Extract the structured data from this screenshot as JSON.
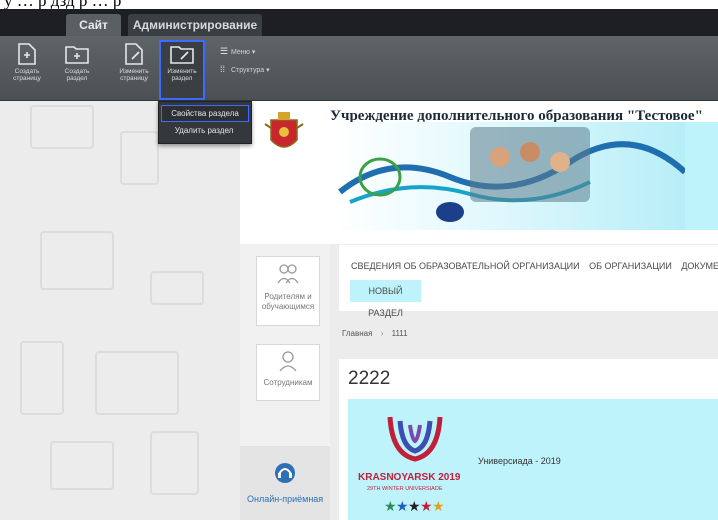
{
  "caption": "у             …    р          дзд    р          …         р",
  "tabs": {
    "site": "Сайт",
    "admin": "Администрирование"
  },
  "toolbar": {
    "create_page": "Создать страницу",
    "create_section": "Создать раздел",
    "edit_page": "Изменить страницу",
    "edit_section": "Изменить раздел",
    "menu": "Меню",
    "structure": "Структура"
  },
  "dropdown": {
    "properties": "Свойства раздела",
    "delete": "Удалить раздел"
  },
  "site": {
    "title": "Учреждение дополнительного образования \"Тестовое\"",
    "cards": {
      "parents": "Родителям и обучающимся",
      "staff": "Сотрудникам"
    },
    "menu_items": [
      "СВЕДЕНИЯ ОБ ОБРАЗОВАТЕЛЬНОЙ ОРГАНИЗАЦИИ",
      "ОБ ОРГАНИЗАЦИИ",
      "ДОКУМЕНТ"
    ],
    "new_section": "НОВЫЙ РАЗДЕЛ",
    "breadcrumb": {
      "home": "Главная",
      "sep": "›",
      "current": "1111"
    },
    "page_heading": "2222",
    "universiade_text": "Универсиада - 2019",
    "universiade_logo": "KRASNOYARSK 2019",
    "universiade_sub": "29TH WINTER UNIVERSIADE",
    "online_reception": "Онлайн-приёмная"
  },
  "colors": {
    "accent_outline": "#3d6bff",
    "banner_cyan": "#bff3fb",
    "link_blue": "#2f6fb5"
  }
}
